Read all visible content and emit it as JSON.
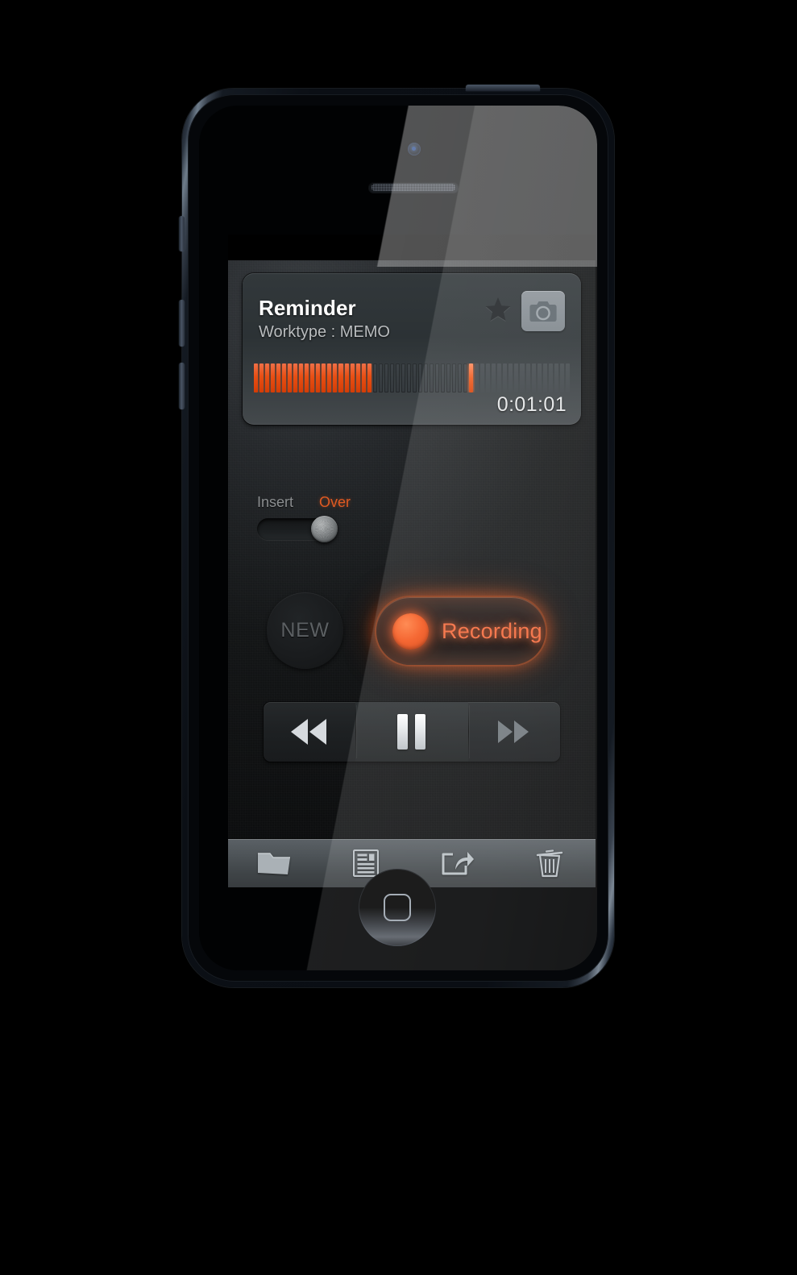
{
  "app": {
    "title": "Reminder",
    "subtitle": "Worktype : MEMO",
    "timer": "0:01:01",
    "accent_color": "#e8551a",
    "screen_background": "#1a1c1e"
  },
  "header_card": {
    "title": "Reminder",
    "subtitle": "Worktype : MEMO",
    "timer": "0:01:01",
    "star_icon": "star-icon",
    "camera_icon": "camera-icon",
    "waveform": {
      "total_bars": 56,
      "played_bars": 21,
      "cursor_index": 38,
      "played_color": "#e8551a",
      "cursor_color": "#f05a1c",
      "empty_color": "#3a4044"
    }
  },
  "mode_toggle": {
    "left_label": "Insert",
    "right_label": "Over",
    "selected": "Over",
    "left_color": "#8b8e90",
    "right_color": "#e05a22",
    "knob_position": "right"
  },
  "actions": {
    "new_label": "NEW",
    "record_label": "Recording",
    "record_state": "active",
    "record_color": "#f4693a"
  },
  "transport": {
    "rewind_icon": "rewind-icon",
    "pause_icon": "pause-icon",
    "forward_icon": "fast-forward-icon",
    "active": "pause"
  },
  "toolbar": {
    "items": [
      {
        "name": "folder-icon",
        "label": "Folder"
      },
      {
        "name": "document-icon",
        "label": "Notes"
      },
      {
        "name": "share-icon",
        "label": "Share"
      },
      {
        "name": "trash-icon",
        "label": "Delete"
      }
    ]
  },
  "device": {
    "model": "iPhone 5 Black",
    "body_color": "#0b0f15"
  }
}
